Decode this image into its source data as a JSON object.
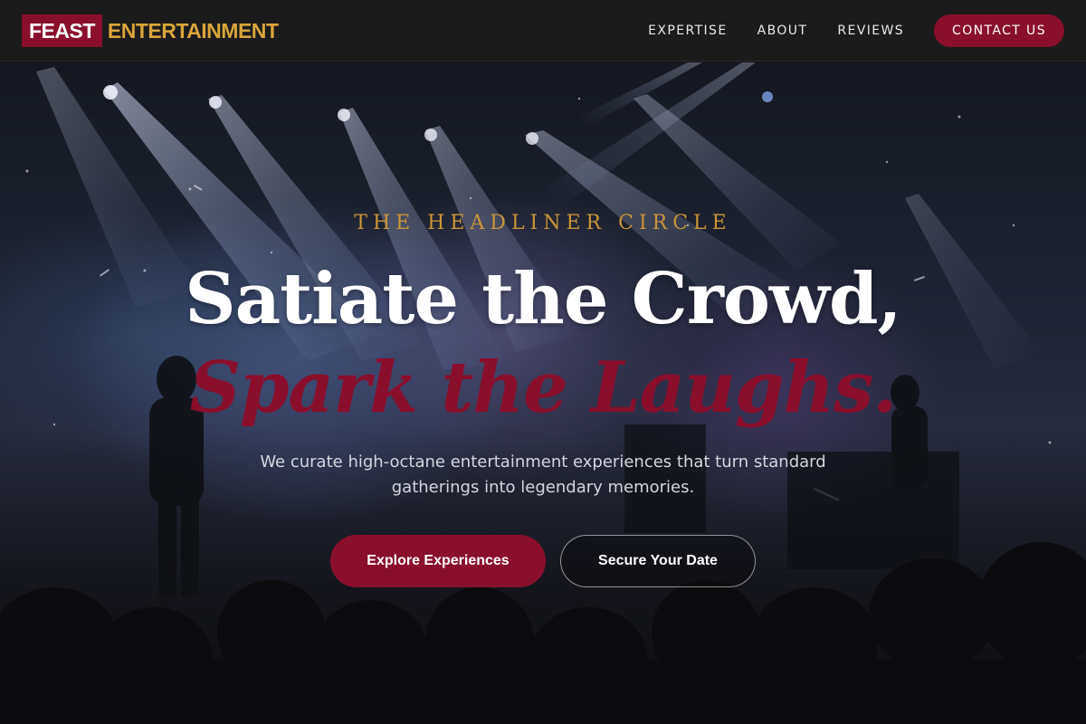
{
  "brand": {
    "logo_box": "FEAST",
    "logo_text": "ENTERTAINMENT"
  },
  "nav": {
    "links": [
      "EXPERTISE",
      "ABOUT",
      "REVIEWS"
    ],
    "contact": "CONTACT US"
  },
  "hero": {
    "eyebrow": "THE HEADLINER CIRCLE",
    "headline_line1": "Satiate the Crowd,",
    "headline_line2": "Spark the Laughs.",
    "subtitle": "We curate high-octane entertainment experiences that turn standard gatherings into legendary memories.",
    "primary_button": "Explore Experiences",
    "secondary_button": "Secure Your Date",
    "background": "concert-stage-photo"
  },
  "colors": {
    "brand_red": "#8a0f2c",
    "brand_gold": "#d9a53b",
    "nav_background": "#1b1b1b"
  }
}
